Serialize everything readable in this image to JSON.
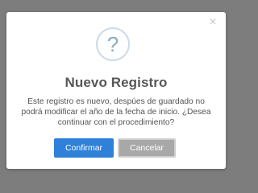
{
  "dialog": {
    "close_icon": "×",
    "question_icon": "?",
    "title": "Nuevo Registro",
    "message": "Este registro es nuevo, despúes de guardado no podrá modificar el año de la fecha de inicio. ¿Desea continuar con el procedimiento?",
    "confirm_label": "Confirmar",
    "cancel_label": "Cancelar"
  },
  "colors": {
    "overlay": "#7d7d7d",
    "dialog_bg": "#ffffff",
    "confirm_bg": "#2f80d9",
    "cancel_bg": "#a8a8a8",
    "icon_ring": "#c8dbea",
    "icon_glyph": "#87adbd",
    "title_text": "#575757"
  }
}
